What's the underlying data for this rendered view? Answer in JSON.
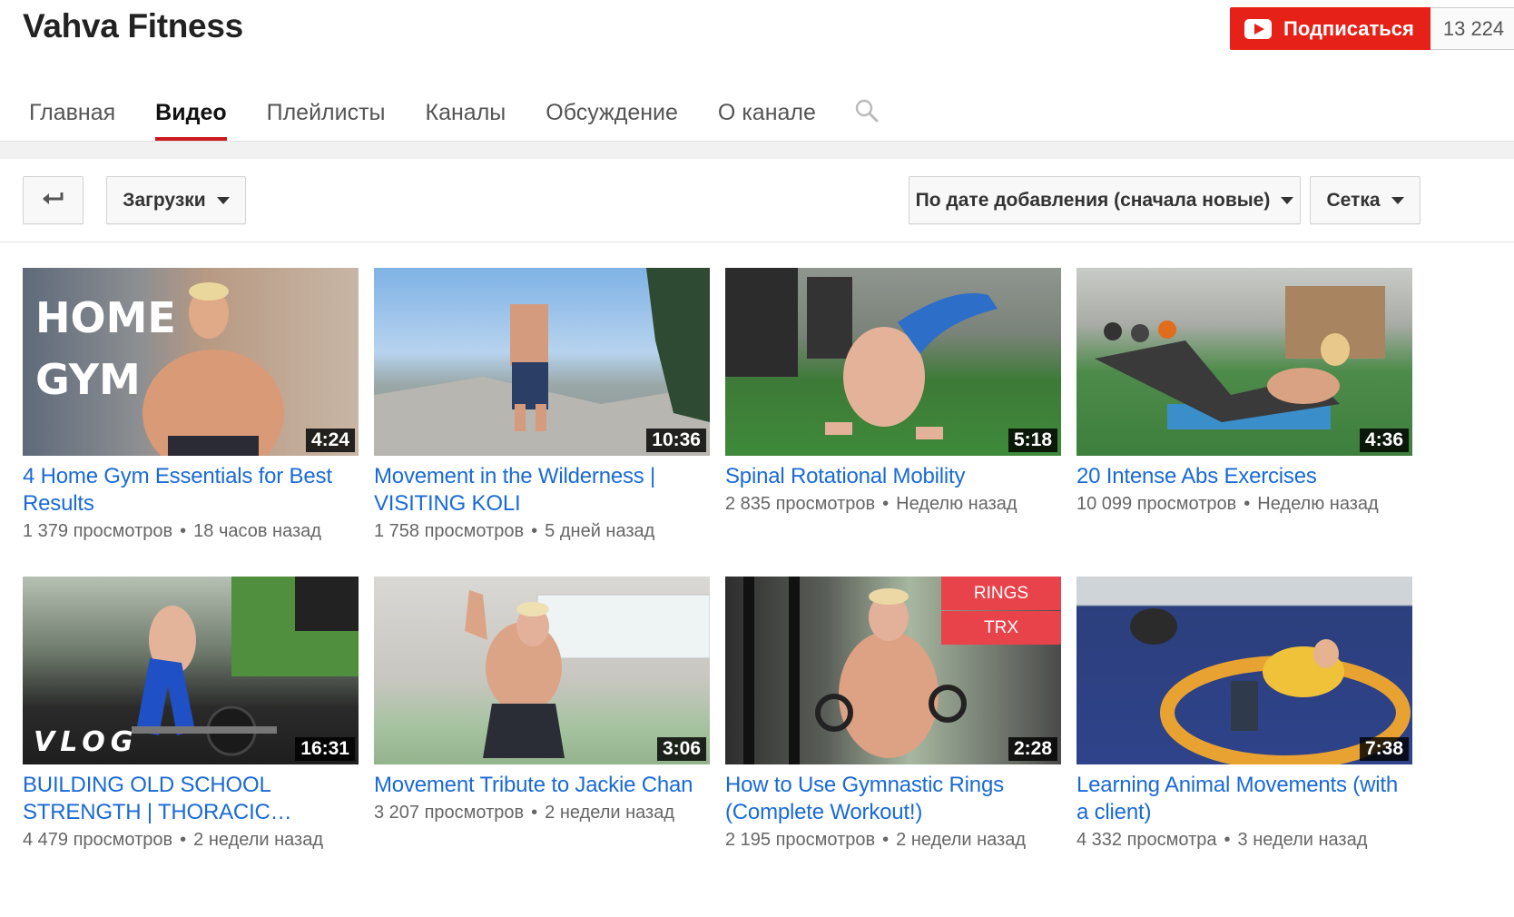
{
  "channel": {
    "title": "Vahva Fitness",
    "subscribe_label": "Подписаться",
    "subscriber_count": "13 224"
  },
  "tabs": [
    {
      "label": "Главная",
      "active": false
    },
    {
      "label": "Видео",
      "active": true
    },
    {
      "label": "Плейлисты",
      "active": false
    },
    {
      "label": "Каналы",
      "active": false
    },
    {
      "label": "Обсуждение",
      "active": false
    },
    {
      "label": "О канале",
      "active": false
    }
  ],
  "toolbar": {
    "back_icon": "back-arrow-icon",
    "uploads_label": "Загрузки",
    "sort_label": "По дате добавления (сначала новые)",
    "view_label": "Сетка"
  },
  "videos": [
    {
      "title": "4 Home Gym Essentials for Best Results",
      "views": "1 379 просмотров",
      "age": "18 часов назад",
      "duration": "4:24",
      "overlay": [
        "HOME",
        "GYM"
      ]
    },
    {
      "title": "Movement in the Wilderness | VISITING KOLI",
      "views": "1 758 просмотров",
      "age": "5 дней назад",
      "duration": "10:36"
    },
    {
      "title": "Spinal Rotational Mobility",
      "views": "2 835 просмотров",
      "age": "Неделю назад",
      "duration": "5:18"
    },
    {
      "title": "20 Intense Abs Exercises",
      "views": "10 099 просмотров",
      "age": "Неделю назад",
      "duration": "4:36"
    },
    {
      "title": "BUILDING OLD SCHOOL STRENGTH | THORACIC…",
      "views": "4 479 просмотров",
      "age": "2 недели назад",
      "duration": "16:31",
      "overlay": [
        "VLOG"
      ]
    },
    {
      "title": "Movement Tribute to Jackie Chan",
      "views": "3 207 просмотров",
      "age": "2 недели назад",
      "duration": "3:06"
    },
    {
      "title": "How to Use Gymnastic Rings (Complete Workout!)",
      "views": "2 195 просмотров",
      "age": "2 недели назад",
      "duration": "2:28",
      "overlay": [
        "RINGS",
        "TRX"
      ]
    },
    {
      "title": "Learning Animal Movements (with a client)",
      "views": "4 332 просмотра",
      "age": "3 недели назад",
      "duration": "7:38"
    }
  ],
  "separator": "•",
  "colors": {
    "accent_red": "#e62117",
    "link_blue": "#1a6ad6",
    "tab_underline": "#cc181e"
  }
}
